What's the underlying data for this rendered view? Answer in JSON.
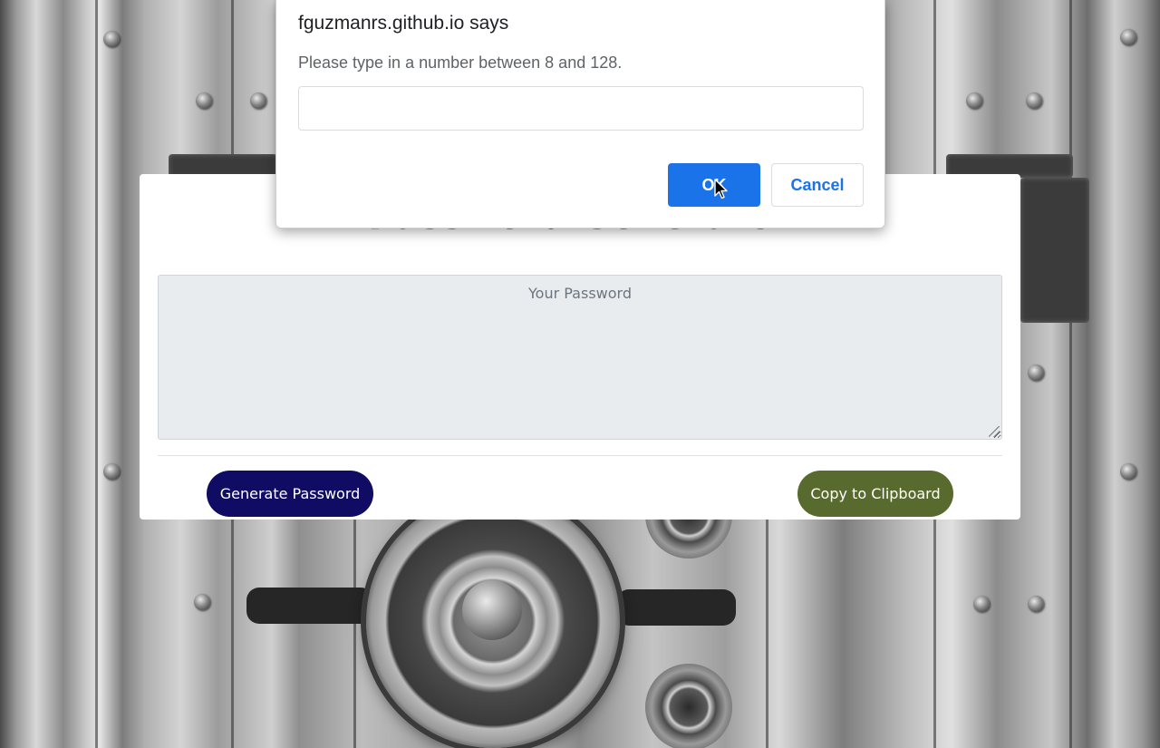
{
  "dialog": {
    "title": "fguzmanrs.github.io says",
    "message": "Please type in a number between 8 and 128.",
    "input_value": "",
    "ok_label": "OK",
    "cancel_label": "Cancel",
    "accent_color": "#1a73e8"
  },
  "card": {
    "title": "Password Generator",
    "password_placeholder": "Your Password",
    "generate_label": "Generate Password",
    "copy_label": "Copy to Clipboard",
    "generate_color": "#100c63",
    "copy_color": "#596a2e"
  },
  "icons": {
    "cursor": "mouse-pointer-icon",
    "resize": "resize-grip-icon"
  }
}
